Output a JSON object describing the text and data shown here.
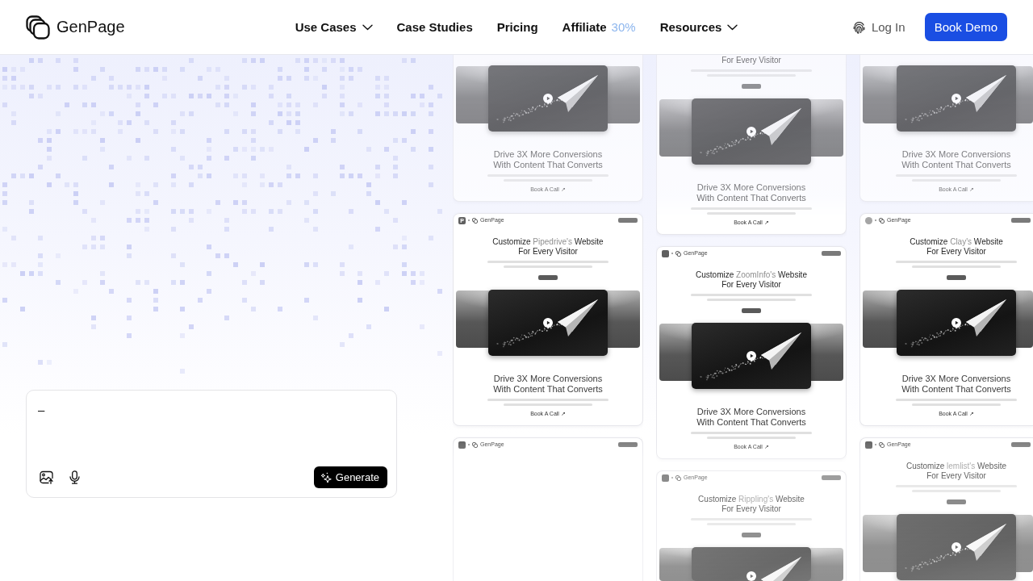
{
  "header": {
    "brand": "GenPage",
    "nav": [
      {
        "label": "Use Cases",
        "dropdown": true
      },
      {
        "label": "Case Studies",
        "dropdown": false
      },
      {
        "label": "Pricing",
        "dropdown": false
      },
      {
        "label": "Affiliate",
        "badge": "30%",
        "dropdown": false
      },
      {
        "label": "Resources",
        "dropdown": true
      }
    ],
    "login": "Log In",
    "cta": "Book Demo"
  },
  "prompt": {
    "value": "–",
    "button": "Generate"
  },
  "columns": [
    {
      "cut_right": false,
      "cards": [
        {
          "cut_top": true,
          "sections": [
            {
              "kind": "video"
            },
            {
              "kind": "headline",
              "lines": [
                "Drive 3X More Conversions",
                "With Content That Converts"
              ]
            },
            {
              "kind": "text"
            },
            {
              "kind": "link",
              "text": "Book A Call ↗"
            }
          ]
        },
        {
          "cut_top": false,
          "sections": [
            {
              "kind": "header",
              "brand": "GenPage",
              "logo": {
                "kind": "square",
                "text": "P"
              }
            },
            {
              "kind": "title",
              "lines": [
                [
                  {
                    "text": "Customize ",
                    "muted": false
                  },
                  {
                    "text": "Pipedrive's",
                    "muted": true
                  },
                  {
                    "text": " Website",
                    "muted": false
                  }
                ],
                [
                  {
                    "text": "For Every Visitor",
                    "muted": false
                  }
                ]
              ]
            },
            {
              "kind": "text"
            },
            {
              "kind": "pill"
            },
            {
              "kind": "video"
            },
            {
              "kind": "headline",
              "lines": [
                "Drive 3X More Conversions",
                "With Content That Converts"
              ]
            },
            {
              "kind": "text"
            },
            {
              "kind": "link",
              "text": "Book A Call ↗"
            }
          ]
        },
        {
          "cut_top": false,
          "sections": [
            {
              "kind": "header",
              "brand": "GenPage",
              "logo": {
                "kind": "square"
              }
            }
          ]
        }
      ]
    },
    {
      "cut_right": false,
      "cards": [
        {
          "cut_top": true,
          "sections": [
            {
              "kind": "title",
              "lines": [
                [
                  {
                    "text": "For Every Visitor",
                    "muted": false
                  }
                ]
              ]
            },
            {
              "kind": "text"
            },
            {
              "kind": "pill"
            },
            {
              "kind": "video"
            },
            {
              "kind": "headline",
              "lines": [
                "Drive 3X More Conversions",
                "With Content That Converts"
              ]
            },
            {
              "kind": "text"
            },
            {
              "kind": "link",
              "text": "Book A Call ↗"
            }
          ]
        },
        {
          "cut_top": false,
          "sections": [
            {
              "kind": "header",
              "brand": "GenPage",
              "logo": {
                "kind": "square"
              }
            },
            {
              "kind": "title",
              "lines": [
                [
                  {
                    "text": "Customize ",
                    "muted": false
                  },
                  {
                    "text": "ZoomInfo's",
                    "muted": true
                  },
                  {
                    "text": " Website",
                    "muted": false
                  }
                ],
                [
                  {
                    "text": "For Every Visitor",
                    "muted": false
                  }
                ]
              ]
            },
            {
              "kind": "text"
            },
            {
              "kind": "pill"
            },
            {
              "kind": "video"
            },
            {
              "kind": "headline",
              "lines": [
                "Drive 3X More Conversions",
                "With Content That Converts"
              ]
            },
            {
              "kind": "text"
            },
            {
              "kind": "link",
              "text": "Book A Call ↗"
            }
          ]
        },
        {
          "cut_top": false,
          "sections": [
            {
              "kind": "header",
              "brand": "GenPage",
              "logo": {
                "kind": "square"
              }
            },
            {
              "kind": "title",
              "lines": [
                [
                  {
                    "text": "Customize ",
                    "muted": false
                  },
                  {
                    "text": "Rippling's",
                    "muted": true
                  },
                  {
                    "text": " Website",
                    "muted": false
                  }
                ],
                [
                  {
                    "text": "For Every Visitor",
                    "muted": false
                  }
                ]
              ]
            },
            {
              "kind": "text"
            },
            {
              "kind": "pill"
            },
            {
              "kind": "video"
            }
          ]
        }
      ]
    },
    {
      "cut_right": true,
      "cards": [
        {
          "cut_top": true,
          "sections": [
            {
              "kind": "video"
            },
            {
              "kind": "headline",
              "lines": [
                "Drive 3X More Conversions",
                "With Content That Converts"
              ]
            },
            {
              "kind": "text"
            },
            {
              "kind": "link",
              "text": "Book A Call ↗"
            }
          ]
        },
        {
          "cut_top": false,
          "sections": [
            {
              "kind": "header",
              "brand": "GenPage",
              "logo": {
                "kind": "circle"
              }
            },
            {
              "kind": "title",
              "lines": [
                [
                  {
                    "text": "Customize ",
                    "muted": false
                  },
                  {
                    "text": "Clay's",
                    "muted": true
                  },
                  {
                    "text": " Website",
                    "muted": false
                  }
                ],
                [
                  {
                    "text": "For Every Visitor",
                    "muted": false
                  }
                ]
              ]
            },
            {
              "kind": "text"
            },
            {
              "kind": "pill"
            },
            {
              "kind": "video"
            },
            {
              "kind": "headline",
              "lines": [
                "Drive 3X More Conversions",
                "With Content That Converts"
              ]
            },
            {
              "kind": "text"
            },
            {
              "kind": "link",
              "text": "Book A Call ↗"
            }
          ]
        },
        {
          "cut_top": false,
          "sections": [
            {
              "kind": "header",
              "brand": "GenPage",
              "logo": {
                "kind": "square"
              }
            },
            {
              "kind": "title",
              "lines": [
                [
                  {
                    "text": "Customize ",
                    "muted": false
                  },
                  {
                    "text": "lemlist's",
                    "muted": true
                  },
                  {
                    "text": " Website",
                    "muted": false
                  }
                ],
                [
                  {
                    "text": "For Every Visitor",
                    "muted": false
                  }
                ]
              ]
            },
            {
              "kind": "text"
            },
            {
              "kind": "pill"
            },
            {
              "kind": "video"
            }
          ]
        }
      ]
    }
  ]
}
